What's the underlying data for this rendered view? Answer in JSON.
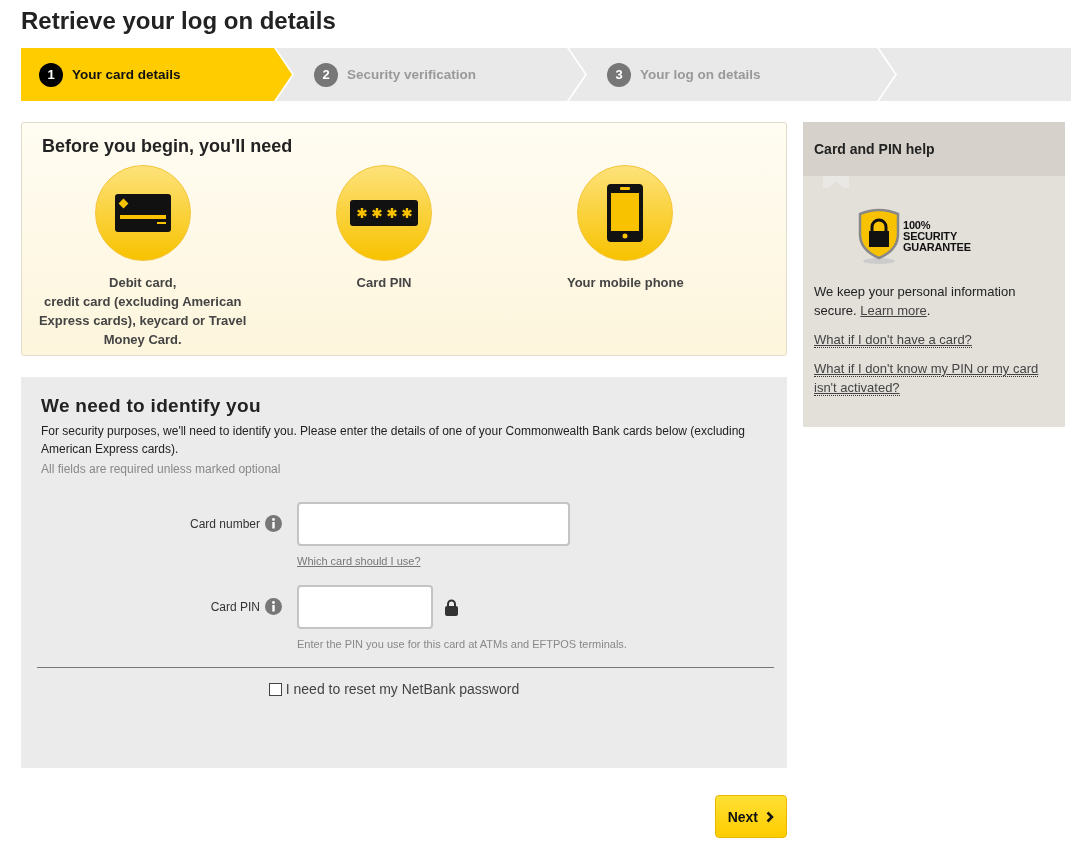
{
  "page_title": "Retrieve your log on details",
  "steps": [
    {
      "number": "1",
      "label": "Your card details",
      "selected": true
    },
    {
      "number": "2",
      "label": "Security verification",
      "selected": false
    },
    {
      "number": "3",
      "label": "Your log on details",
      "selected": false
    }
  ],
  "requirements": {
    "title": "Before you begin, you'll need",
    "items": [
      {
        "kind": "card",
        "label": "Debit card,\ncredit card (excluding American Express cards), keycard or Travel Money Card."
      },
      {
        "kind": "pin",
        "label": "Card PIN"
      },
      {
        "kind": "phone",
        "label": "Your mobile phone"
      }
    ]
  },
  "identify": {
    "title": "We need to identify you",
    "intro": "For security purposes, we'll need to identify you. Please enter the details of one of your Commonwealth Bank cards below (excluding American Express cards).",
    "required_note": "All fields are required unless marked optional",
    "fields": [
      {
        "kind": "card_number",
        "label": "Card number",
        "link": "Which card should I use?"
      },
      {
        "kind": "pin",
        "label": "Card PIN",
        "hint": "Enter the PIN you use for this card at ATMs and EFTPOS terminals."
      }
    ],
    "checkbox": {
      "label": "I need to reset my NetBank password",
      "checked": false
    }
  },
  "next_button": "Next",
  "help": {
    "title": "Card and PIN help",
    "badge_text": "100% SECURITY GUARANTEE",
    "security_text": "We keep your personal information secure.",
    "learn_more_link": "Learn more",
    "security_text_end": ".",
    "links": [
      "What if I don't have a card?",
      "What if I don't know my PIN or my card isn't activated?"
    ]
  }
}
